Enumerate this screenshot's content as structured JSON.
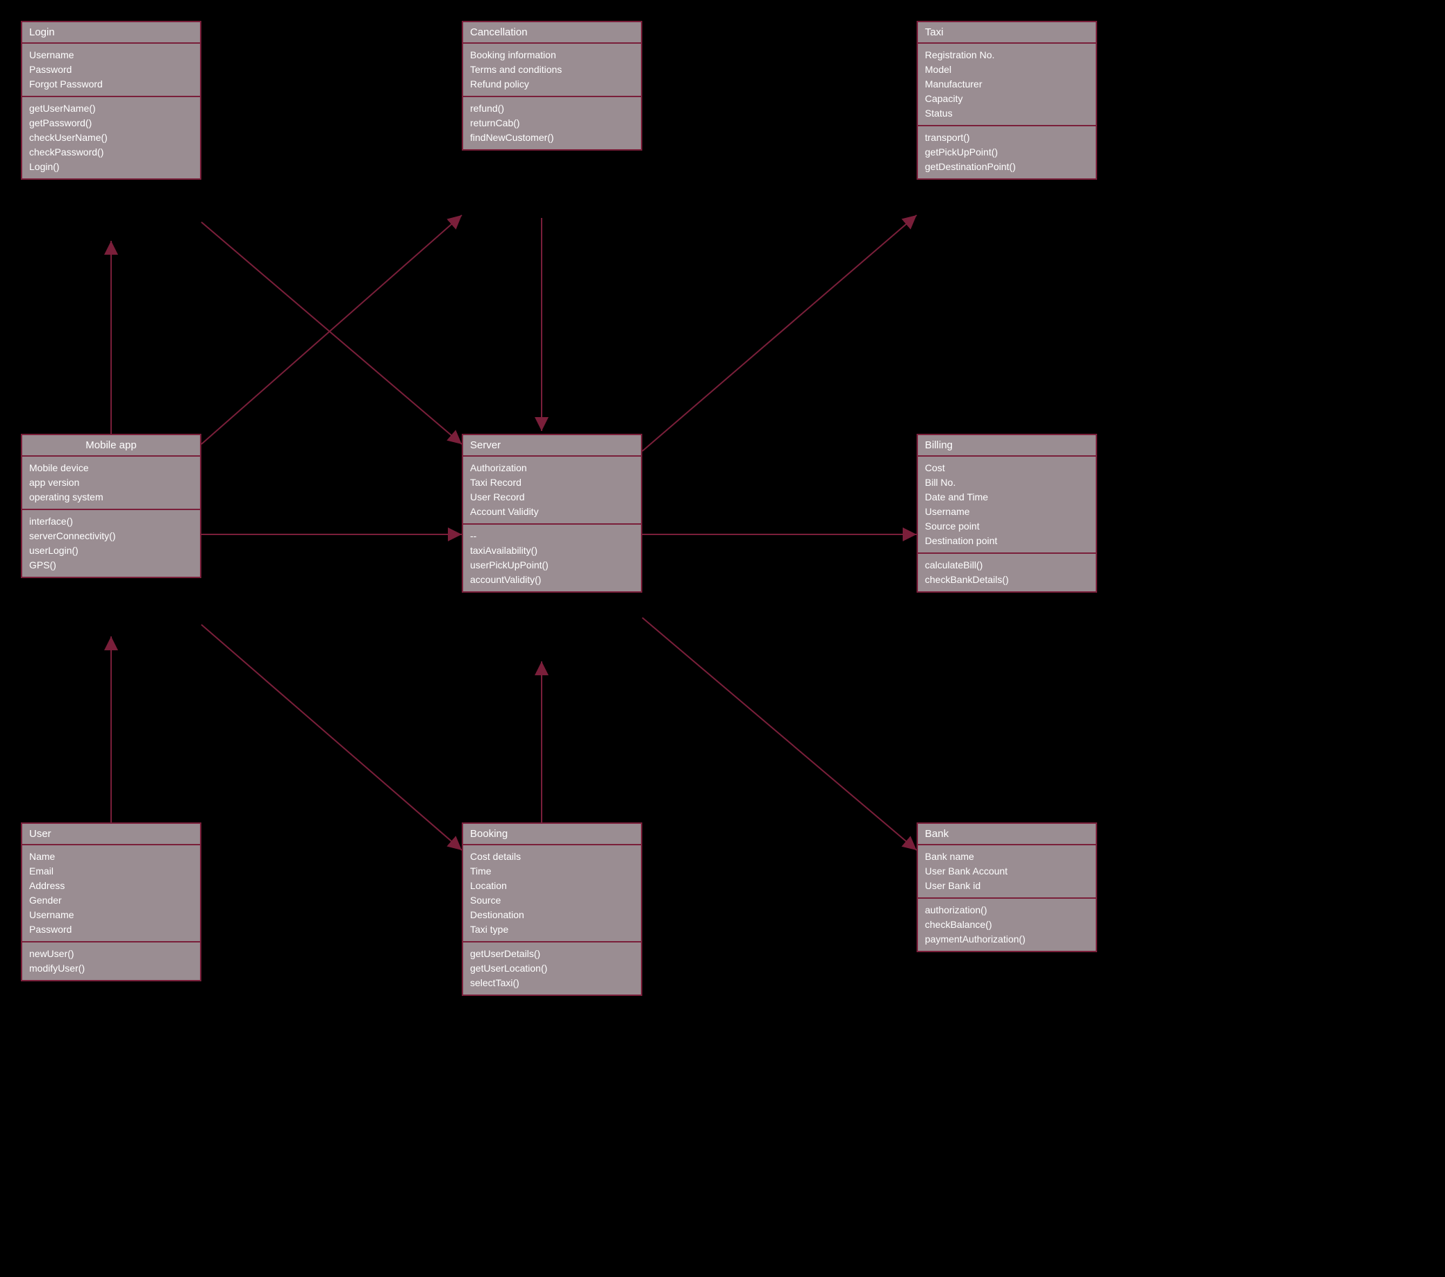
{
  "classes": {
    "login": {
      "title": "Login",
      "attrs": [
        "Username",
        "Password",
        "Forgot Password"
      ],
      "methods": [
        "getUserName()",
        "getPassword()",
        "checkUserName()",
        "checkPassword()",
        "Login()"
      ]
    },
    "cancellation": {
      "title": "Cancellation",
      "attrs": [
        "Booking information",
        "Terms and conditions",
        "Refund policy"
      ],
      "methods": [
        "refund()",
        "returnCab()",
        "findNewCustomer()"
      ]
    },
    "taxi": {
      "title": "Taxi",
      "attrs": [
        "Registration No.",
        "Model",
        "Manufacturer",
        "Capacity",
        "Status"
      ],
      "methods": [
        "transport()",
        "getPickUpPoint()",
        "getDestinationPoint()"
      ]
    },
    "mobileapp": {
      "title": "Mobile app",
      "attrs": [
        "Mobile device",
        "app version",
        "operating system"
      ],
      "methods": [
        "interface()",
        "serverConnectivity()",
        "userLogin()",
        "GPS()"
      ]
    },
    "server": {
      "title": "Server",
      "attrs": [
        "Authorization",
        "Taxi Record",
        "User Record",
        "Account Validity"
      ],
      "methods": [
        "--",
        "taxiAvailability()",
        "userPickUpPoint()",
        "accountValidity()"
      ]
    },
    "billing": {
      "title": "Billing",
      "attrs": [
        "Cost",
        "Bill No.",
        "Date and Time",
        "Username",
        "Source point",
        "Destination point"
      ],
      "methods": [
        "calculateBill()",
        "checkBankDetails()"
      ]
    },
    "user": {
      "title": "User",
      "attrs": [
        "Name",
        "Email",
        "Address",
        "Gender",
        "Username",
        "Password"
      ],
      "methods": [
        "newUser()",
        "modifyUser()"
      ]
    },
    "booking": {
      "title": "Booking",
      "attrs": [
        "Cost details",
        "Time",
        "Location",
        "Source",
        "Destionation",
        "Taxi type"
      ],
      "methods": [
        "getUserDetails()",
        "getUserLocation()",
        "selectTaxi()"
      ]
    },
    "bank": {
      "title": "Bank",
      "attrs": [
        "Bank name",
        "User Bank Account",
        "User Bank id"
      ],
      "methods": [
        "authorization()",
        "checkBalance()",
        "paymentAuthorization()"
      ]
    }
  }
}
